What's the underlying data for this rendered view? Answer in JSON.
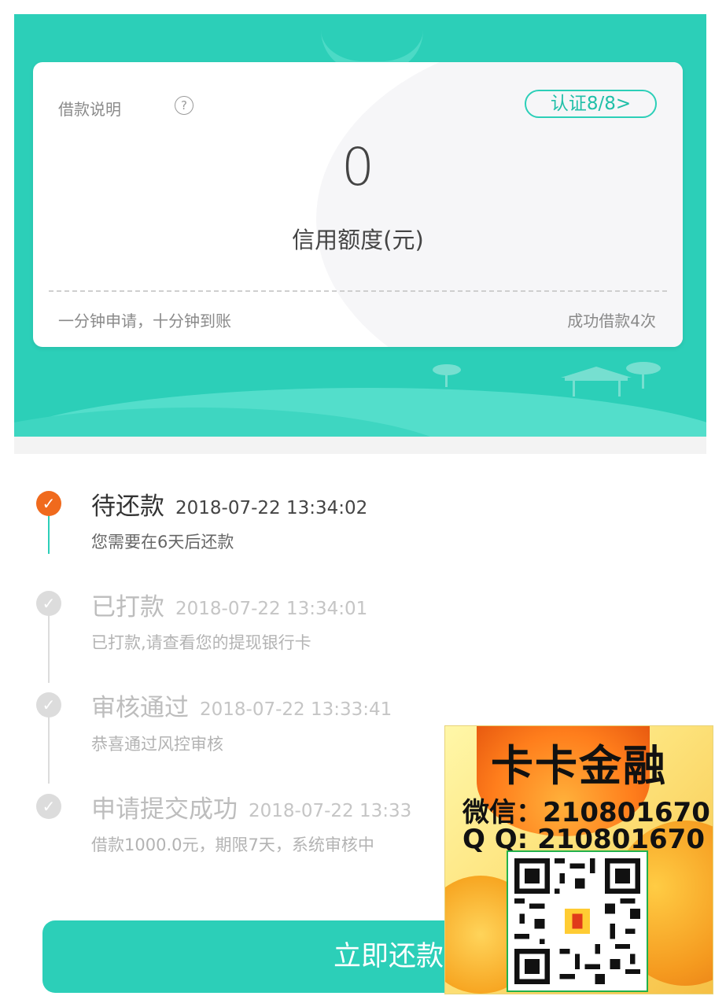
{
  "card": {
    "title": "借款说明",
    "help_glyph": "?",
    "verify_label": "认证8/8>",
    "credit_value": "0",
    "credit_label": "信用额度(元)",
    "footer_left": "一分钟申请，十分钟到账",
    "footer_right": "成功借款4次"
  },
  "timeline": [
    {
      "title": "待还款",
      "time": "2018-07-22 13:34:02",
      "desc": "您需要在6天后还款",
      "active": true,
      "icon": "check-icon"
    },
    {
      "title": "已打款",
      "time": "2018-07-22 13:34:01",
      "desc": "已打款,请查看您的提现银行卡",
      "active": false,
      "icon": "check-icon"
    },
    {
      "title": "审核通过",
      "time": "2018-07-22 13:33:41",
      "desc": "恭喜通过风控审核",
      "active": false,
      "icon": "check-icon"
    },
    {
      "title": "申请提交成功",
      "time": "2018-07-22 13:33",
      "desc": "借款1000.0元，期限7天，系统审核中",
      "active": false,
      "icon": "check-icon"
    }
  ],
  "repay_button": "立即还款",
  "ad": {
    "title": "卡卡金融",
    "wechat": "微信：210801670",
    "qq": "Q  Q: 210801670"
  },
  "colors": {
    "accent": "#2ccfb8",
    "active_dot": "#f06a1d",
    "inactive_dot": "#dcdcdc"
  }
}
